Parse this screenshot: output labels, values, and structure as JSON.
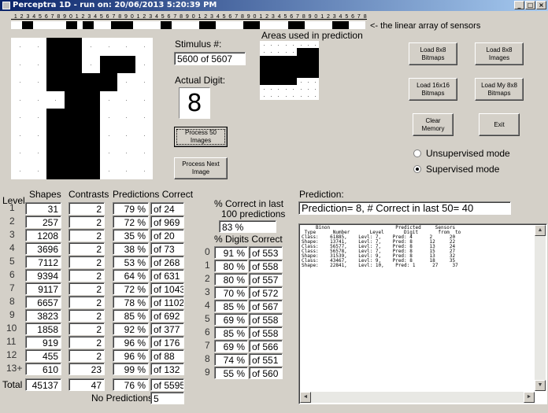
{
  "window": {
    "title": "Perceptra 1D - run on: 20/06/2013  5:20:39 PM",
    "controls": [
      "_",
      "□",
      "×"
    ]
  },
  "sensors": {
    "labels": "_1_2_3_4_5_6_7_8_9_0_1_2_3_4_5_6_7_8_9_0_1_2_3_4_5_6_7_8_9_0_1_2_3_4_5_6_7_8_9_0_1_2_3_4_5_6_7_8_9_0_1_2_3_4_5_6_7_8_9_0_1_2_3_4",
    "caption": "<- the linear array of sensors",
    "states": [
      0,
      0,
      1,
      1,
      0,
      0,
      0,
      0,
      0,
      0,
      1,
      1,
      0,
      1,
      1,
      0,
      0,
      0,
      1,
      1,
      1,
      1,
      0,
      0,
      0,
      0,
      0,
      1,
      1,
      0,
      0,
      0,
      0,
      0,
      1,
      1,
      1,
      0,
      0,
      0,
      0,
      0,
      1,
      1,
      1,
      0,
      0,
      0,
      0,
      0,
      1,
      1,
      1,
      0,
      0,
      0,
      0,
      0,
      1,
      1,
      1,
      0,
      0,
      0
    ]
  },
  "image_grid": {
    "rows": [
      [
        0,
        0,
        1,
        1,
        0,
        0,
        0,
        0
      ],
      [
        0,
        0,
        1,
        1,
        0,
        1,
        1,
        0
      ],
      [
        0,
        0,
        1,
        1,
        1,
        1,
        0,
        0
      ],
      [
        0,
        0,
        0,
        1,
        1,
        0,
        0,
        0
      ],
      [
        0,
        0,
        1,
        1,
        1,
        0,
        0,
        0
      ],
      [
        0,
        0,
        1,
        1,
        1,
        0,
        0,
        0
      ],
      [
        0,
        0,
        1,
        1,
        1,
        0,
        0,
        0
      ],
      [
        0,
        0,
        1,
        1,
        1,
        0,
        0,
        0
      ]
    ]
  },
  "stimulus": {
    "label": "Stimulus #:",
    "value": "5600  of 5607"
  },
  "actual_digit": {
    "label": "Actual Digit:",
    "value": "8"
  },
  "areas": {
    "label": "Areas used in prediction",
    "rows": [
      [
        0,
        0,
        0,
        0,
        0,
        0,
        0,
        0
      ],
      [
        0,
        0,
        0,
        0,
        0,
        1,
        1,
        1
      ],
      [
        1,
        1,
        1,
        1,
        1,
        1,
        1,
        1
      ],
      [
        1,
        1,
        1,
        1,
        1,
        1,
        1,
        1
      ],
      [
        1,
        1,
        1,
        1,
        1,
        1,
        1,
        1
      ],
      [
        1,
        1,
        1,
        1,
        1,
        0,
        0,
        0
      ],
      [
        0,
        0,
        0,
        0,
        0,
        0,
        0,
        0
      ],
      [
        0,
        0,
        0,
        0,
        0,
        0,
        0,
        0
      ]
    ]
  },
  "buttons": {
    "process50": "Process 50 Images",
    "processNext": "Process Next Image",
    "load8x8bitmaps": "Load 8x8 Bitmaps",
    "load8x8images": "Load 8x8 Images",
    "load16x16bitmaps": "Load 16x16 Bitmaps",
    "loadMy8x8bitmaps": "Load My 8x8 Bitmaps",
    "clearMemory": "Clear Memory",
    "exit": "Exit"
  },
  "modes": {
    "unsupervised": "Unsupervised mode",
    "supervised": "Supervised mode",
    "selected": "supervised"
  },
  "levels_table": {
    "headers": {
      "level": "Level",
      "shapes": "Shapes",
      "contrasts": "Contrasts",
      "predictions": "Predictions Correct"
    },
    "rows": [
      {
        "level": "1",
        "shapes": "31",
        "contrasts": "2",
        "pct": "79 %",
        "of": "of 24"
      },
      {
        "level": "2",
        "shapes": "257",
        "contrasts": "2",
        "pct": "72 %",
        "of": "of 969"
      },
      {
        "level": "3",
        "shapes": "1208",
        "contrasts": "2",
        "pct": "35 %",
        "of": "of 20"
      },
      {
        "level": "4",
        "shapes": "3696",
        "contrasts": "2",
        "pct": "38 %",
        "of": "of 73"
      },
      {
        "level": "5",
        "shapes": "7112",
        "contrasts": "2",
        "pct": "53 %",
        "of": "of 268"
      },
      {
        "level": "6",
        "shapes": "9394",
        "contrasts": "2",
        "pct": "64 %",
        "of": "of 631"
      },
      {
        "level": "7",
        "shapes": "9117",
        "contrasts": "2",
        "pct": "72 %",
        "of": "of 1043"
      },
      {
        "level": "8",
        "shapes": "6657",
        "contrasts": "2",
        "pct": "78 %",
        "of": "of 1102"
      },
      {
        "level": "9",
        "shapes": "3823",
        "contrasts": "2",
        "pct": "85 %",
        "of": "of 692"
      },
      {
        "level": "10",
        "shapes": "1858",
        "contrasts": "2",
        "pct": "92 %",
        "of": "of 377"
      },
      {
        "level": "11",
        "shapes": "919",
        "contrasts": "2",
        "pct": "96 %",
        "of": "of 176"
      },
      {
        "level": "12",
        "shapes": "455",
        "contrasts": "2",
        "pct": "96 %",
        "of": "of 88"
      },
      {
        "level": "13+",
        "shapes": "610",
        "contrasts": "23",
        "pct": "99 %",
        "of": "of 132"
      }
    ],
    "total": {
      "label": "Total",
      "shapes": "45137",
      "contrasts": "47",
      "pct": "76 %",
      "of": "of 5595"
    },
    "no_predictions": {
      "label": "No Predictions:",
      "value": "5"
    }
  },
  "last100": {
    "label_line1": "% Correct in last",
    "label_line2": "100 predictions",
    "value": "83 %"
  },
  "digits_table": {
    "header": "% Digits Correct",
    "rows": [
      {
        "digit": "0",
        "pct": "91 %",
        "of": "of 553"
      },
      {
        "digit": "1",
        "pct": "80 %",
        "of": "of 558"
      },
      {
        "digit": "2",
        "pct": "80 %",
        "of": "of 557"
      },
      {
        "digit": "3",
        "pct": "70 %",
        "of": "of 572"
      },
      {
        "digit": "4",
        "pct": "85 %",
        "of": "of 567"
      },
      {
        "digit": "5",
        "pct": "69 %",
        "of": "of 558"
      },
      {
        "digit": "6",
        "pct": "85 %",
        "of": "of 558"
      },
      {
        "digit": "7",
        "pct": "69 %",
        "of": "of 566"
      },
      {
        "digit": "8",
        "pct": "74 %",
        "of": "of 551"
      },
      {
        "digit": "9",
        "pct": "55 %",
        "of": "of 560"
      }
    ]
  },
  "prediction": {
    "label": "Prediction:",
    "value": "Prediction= 8, # Correct in last 50= 40"
  },
  "binon_list": {
    "header_line1": "     Binon                       Predicted     Sensors",
    "header_line2": " Type      Number       Level       Digit       from  to",
    "rows": [
      "Class:    61885,    Levl: 7,    Pred: 4      2      20",
      "Shape:    13741,    Levl: 7,    Pred: 8      12     22",
      "Class:    56577,    Levl: 7,    Pred: 8      13     24",
      "Class:    56578,    Levl: 7,    Pred: 8      15     27",
      "Shape:    31539,    Levl: 9,    Pred: 8      13     32",
      "Class:    43467,    Levl: 9,    Pred: 8      18     35",
      "Shape:    22841,    Levl: 10,    Pred: 1      27     37"
    ]
  }
}
